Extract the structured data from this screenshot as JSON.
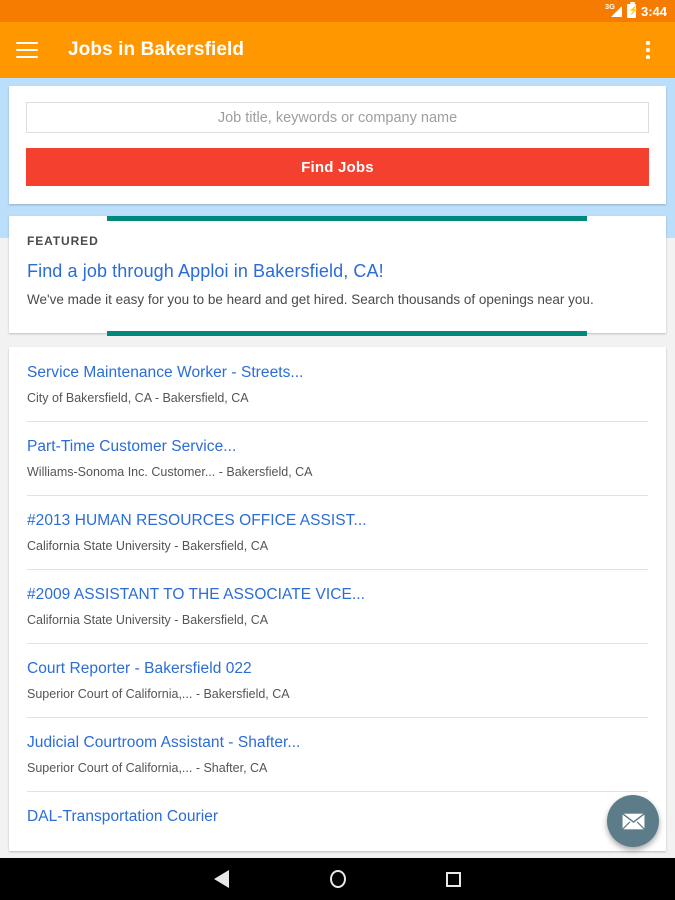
{
  "status_bar": {
    "network": "3G",
    "network_icon": "signal-3g-icon",
    "battery_icon": "battery-charging-icon",
    "time": "3:44"
  },
  "app_bar": {
    "menu_icon": "hamburger-menu-icon",
    "title": "Jobs in Bakersfield",
    "overflow_icon": "overflow-menu-icon"
  },
  "search": {
    "placeholder": "Job title, keywords or company name",
    "value": "",
    "button_label": "Find Jobs"
  },
  "featured": {
    "label": "FEATURED",
    "title": "Find a job through Apploi in Bakersfield, CA!",
    "description": "We've made it easy for you to be heard and get hired. Search thousands of openings near you.",
    "accent_color": "#00897B"
  },
  "jobs": [
    {
      "title": "Service Maintenance Worker - Streets...",
      "meta": "City of Bakersfield, CA - Bakersfield, CA"
    },
    {
      "title": "Part-Time Customer Service...",
      "meta": "Williams-Sonoma Inc. Customer... - Bakersfield, CA"
    },
    {
      "title": "#2013 HUMAN RESOURCES OFFICE ASSIST...",
      "meta": "California State University - Bakersfield, CA"
    },
    {
      "title": "#2009 ASSISTANT TO THE ASSOCIATE VICE...",
      "meta": "California State University - Bakersfield, CA"
    },
    {
      "title": "Court Reporter - Bakersfield 022",
      "meta": "Superior Court of California,... - Bakersfield, CA"
    },
    {
      "title": "Judicial Courtroom Assistant - Shafter...",
      "meta": "Superior Court of California,... - Shafter, CA"
    },
    {
      "title": "DAL-Transportation Courier",
      "meta": ""
    }
  ],
  "fab": {
    "icon": "envelope-icon",
    "color": "#5C7C8A"
  },
  "nav_bar": {
    "back_icon": "back-triangle-icon",
    "home_icon": "home-circle-icon",
    "recents_icon": "recents-square-icon"
  },
  "colors": {
    "app_bar": "#FF9800",
    "status_bar": "#F57C00",
    "page_background": "#BBDEFB",
    "primary_button": "#F4402F",
    "link": "#2A6CD8"
  }
}
